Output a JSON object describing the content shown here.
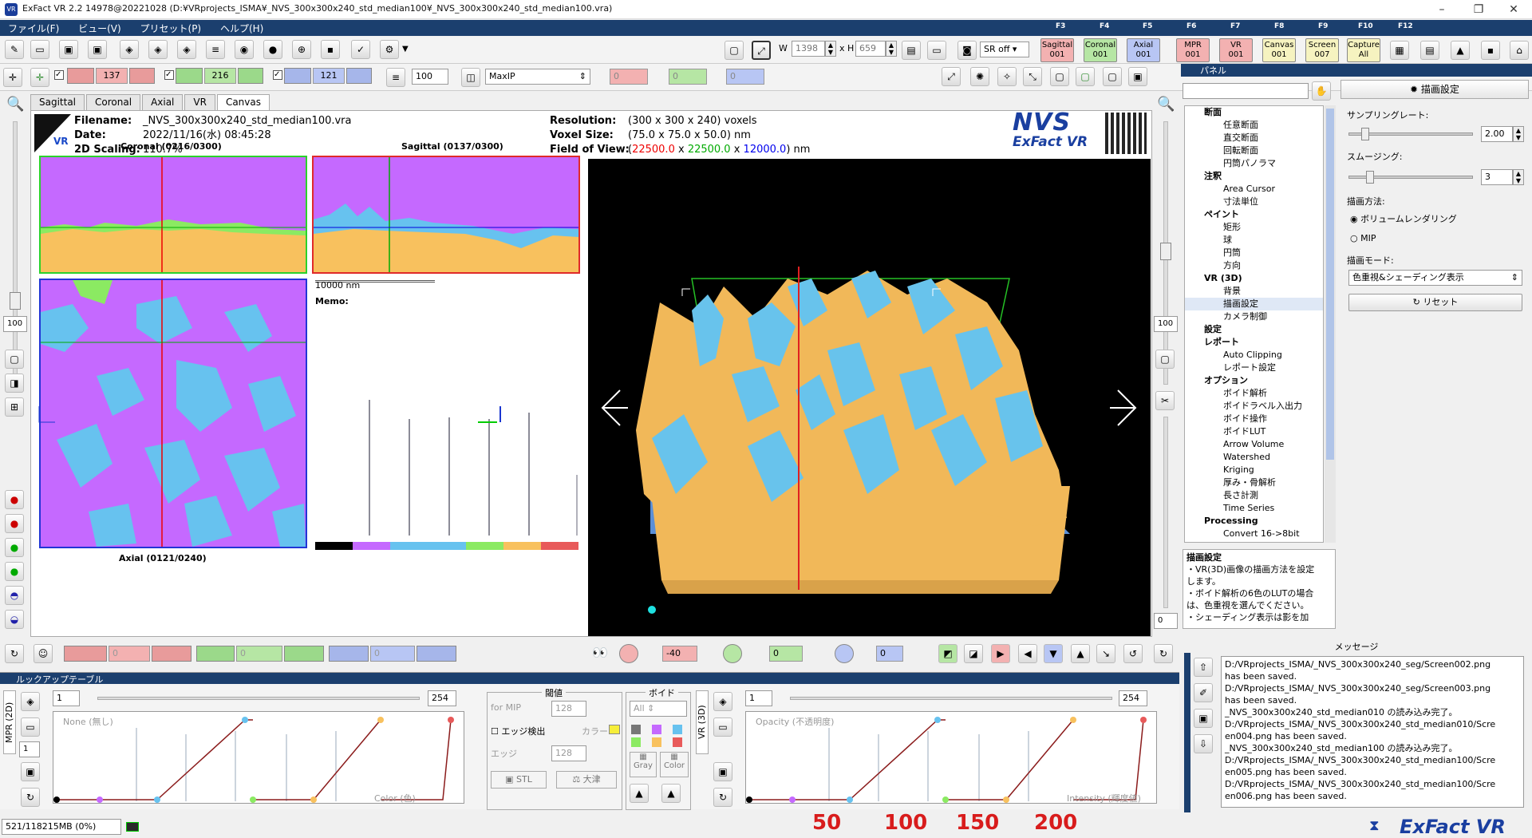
{
  "window": {
    "title": "ExFact VR 2.2 14978@20221028 (D:¥VRprojects_ISMA¥_NVS_300x300x240_std_median100¥_NVS_300x300x240_std_median100.vra)",
    "app_icon": "VR"
  },
  "menu": [
    "ファイル(F)",
    "ビュー(V)",
    "プリセット(P)",
    "ヘルプ(H)"
  ],
  "fkeys": [
    "F3",
    "F4",
    "F5",
    "F6",
    "F7",
    "F8",
    "F9",
    "F10",
    "F12"
  ],
  "toolbar": {
    "w_label": "W",
    "w_value": "1398",
    "h_label": "x H",
    "h_value": "659",
    "sr_value": "SR off",
    "mode_buttons": [
      {
        "label": "Sagittal",
        "sub": "001",
        "color": "#f3b1b1"
      },
      {
        "label": "Coronal",
        "sub": "001",
        "color": "#b6e6a4"
      },
      {
        "label": "Axial",
        "sub": "001",
        "color": "#b8c6f4"
      },
      {
        "label": "MPR",
        "sub": "001",
        "color": "#f3b1b1"
      },
      {
        "label": "VR",
        "sub": "001",
        "color": "#f3b1b1"
      },
      {
        "label": "Canvas",
        "sub": "001",
        "color": "#f6f3c0"
      },
      {
        "label": "Screen",
        "sub": "007",
        "color": "#f6f3c0"
      },
      {
        "label": "Capture",
        "sub": "All",
        "color": "#f6f3c0"
      }
    ]
  },
  "toolbar2": {
    "slice_sag": "137",
    "slice_cor": "216",
    "slice_ax": "121",
    "thickness": "100",
    "projection": "MaxIP",
    "v_red": "0",
    "v_green": "0",
    "v_blue": "0"
  },
  "tabs": [
    "Sagittal",
    "Coronal",
    "Axial",
    "VR",
    "Canvas"
  ],
  "header": {
    "filename_label": "Filename:",
    "filename": "_NVS_300x300x240_std_median100.vra",
    "date_label": "Date:",
    "date": "2022/11/16(水) 08:45:28",
    "scaling_label": "2D Scaling:",
    "scaling": "110.7%",
    "resolution_label": "Resolution:",
    "resolution": "(300 x 300 x 240) voxels",
    "voxel_label": "Voxel Size:",
    "voxel": "(75.0 x 75.0 x 50.0) nm",
    "fov_label": "Field of View:",
    "fov_open": "(",
    "fov_x": "22500.0",
    "fov_sep1": " x ",
    "fov_y": "22500.0",
    "fov_sep2": " x ",
    "fov_z": "12000.0",
    "fov_close": ") nm",
    "logo_top": "NVS",
    "logo_bottom": "ExFact VR"
  },
  "views": {
    "coronal": "Coronal (0216/0300)",
    "sagittal": "Sagittal (0137/0300)",
    "axial": "Axial (0121/0240)",
    "scale": "10000 nm",
    "memo": "Memo:"
  },
  "left_sidebar": {
    "top_value": "100",
    "mid_value": "100",
    "bottom_value": "0"
  },
  "vr_controls": {
    "rot_value": "-40",
    "val2": "0",
    "val3": "0"
  },
  "mpr_controls": {
    "v1": "0",
    "v2": "0",
    "v3": "0"
  },
  "panel": {
    "title": "パネル",
    "settings_header": "描画設定",
    "sampling_label": "サンプリングレート:",
    "sampling_value": "2.00",
    "smoothing_label": "スムージング:",
    "smoothing_value": "3",
    "method_label": "描画方法:",
    "method_vr": "ボリュームレンダリング",
    "method_mip": "MIP",
    "mode_label": "描画モード:",
    "mode_value": "色重視&シェーディング表示",
    "reset": "リセット"
  },
  "tree": [
    {
      "t": "断面",
      "l": 0,
      "bold": true,
      "icon": "slice-icon"
    },
    {
      "t": "任意断面",
      "l": 1
    },
    {
      "t": "直交断面",
      "l": 1
    },
    {
      "t": "回転断面",
      "l": 1
    },
    {
      "t": "円筒パノラマ",
      "l": 1
    },
    {
      "t": "注釈",
      "l": 0,
      "bold": true
    },
    {
      "t": "Area Cursor",
      "l": 1
    },
    {
      "t": "寸法単位",
      "l": 1
    },
    {
      "t": "ペイント",
      "l": 0,
      "bold": true
    },
    {
      "t": "矩形",
      "l": 1
    },
    {
      "t": "球",
      "l": 1
    },
    {
      "t": "円筒",
      "l": 1
    },
    {
      "t": "方向",
      "l": 1
    },
    {
      "t": "VR (3D)",
      "l": 0,
      "bold": true
    },
    {
      "t": "背景",
      "l": 1
    },
    {
      "t": "描画設定",
      "l": 1,
      "sel": true
    },
    {
      "t": "カメラ制御",
      "l": 1
    },
    {
      "t": "設定",
      "l": 0,
      "bold": true
    },
    {
      "t": "レポート",
      "l": 0,
      "bold": true
    },
    {
      "t": "Auto Clipping",
      "l": 1
    },
    {
      "t": "レポート設定",
      "l": 1
    },
    {
      "t": "オプション",
      "l": 0,
      "bold": true
    },
    {
      "t": "ボイド解析",
      "l": 1
    },
    {
      "t": "ボイドラベル入出力",
      "l": 1
    },
    {
      "t": "ボイド操作",
      "l": 1
    },
    {
      "t": "ボイドLUT",
      "l": 1
    },
    {
      "t": "Arrow Volume",
      "l": 1
    },
    {
      "t": "Watershed",
      "l": 1
    },
    {
      "t": "Kriging",
      "l": 1
    },
    {
      "t": "厚み・骨解析",
      "l": 1
    },
    {
      "t": "長さ計測",
      "l": 1
    },
    {
      "t": "Time Series",
      "l": 1
    },
    {
      "t": "Processing",
      "l": 0,
      "bold": true
    },
    {
      "t": "Convert 16->8bit",
      "l": 1
    }
  ],
  "help": {
    "title": "描画設定",
    "lines": [
      "・VR(3D)画像の描画方法を設定",
      "します。",
      "・ボイド解析の6色のLUTの場合",
      "は、色重視を選んでください。",
      "・シェーディング表示は影を加"
    ]
  },
  "messages": {
    "title": "メッセージ",
    "lines": [
      "D:/VRprojects_ISMA/_NVS_300x300x240_seg/Screen002.png",
      "has been saved.",
      "D:/VRprojects_ISMA/_NVS_300x300x240_seg/Screen003.png",
      "has been saved.",
      "_NVS_300x300x240_std_median010 の読み込み完了。",
      "D:/VRprojects_ISMA/_NVS_300x300x240_std_median010/Scre",
      "en004.png has been saved.",
      "_NVS_300x300x240_std_median100 の読み込み完了。",
      "D:/VRprojects_ISMA/_NVS_300x300x240_std_median100/Scre",
      "en005.png has been saved.",
      "D:/VRprojects_ISMA/_NVS_300x300x240_std_median100/Scre",
      "en006.png has been saved."
    ]
  },
  "lut": {
    "title": "ルックアップテーブル",
    "mpr_tab": "MPR (2D)",
    "vr_tab": "VR (3D)",
    "min": "1",
    "max": "254",
    "vr_min": "1",
    "vr_max": "254",
    "mpr_caption": "None (無し)",
    "mpr_axis": "Color (色)",
    "vr_caption": "Opacity (不透明度)",
    "vr_axis": "Intensity (輝度値)",
    "mpr_page": "1",
    "threshold_title": "閾値",
    "for_mip": "for MIP",
    "thr_val": "128",
    "edge_label": "エッジ検出",
    "color_label": "カラー",
    "edge_val_label": "エッジ",
    "edge_val": "128",
    "stl": "STL",
    "otsu": "大津",
    "void_title": "ボイド",
    "void_all": "All",
    "gray": "Gray",
    "color": "Color"
  },
  "axis_ticks": [
    "50",
    "100",
    "150",
    "200"
  ],
  "status": {
    "memory": "521/118215MB (0%)",
    "brand": "ExFact VR"
  },
  "colors": {
    "menu": "#1b3f6e",
    "phase_purple": "#c569ff",
    "phase_blue": "#67c2ef",
    "phase_orange": "#f8c15e",
    "phase_green": "#8bea62",
    "lut_line": "#8b1c1c"
  }
}
